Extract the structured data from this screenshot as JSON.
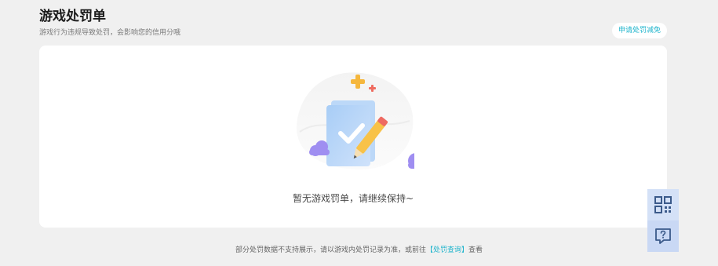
{
  "header": {
    "title": "游戏处罚单",
    "subtitle": "游戏行为违规导致处罚，会影响您的信用分哦",
    "appeal_label": "申请处罚减免"
  },
  "main": {
    "empty_text": "暂无游戏罚单，请继续保持~",
    "illustration_icon": "document-check-pencil-illustration"
  },
  "footer": {
    "note_prefix": "部分处罚数据不支持展示，请以游戏内处罚记录为准，或前往",
    "link_label": "【处罚查询】",
    "note_suffix": "查看"
  },
  "float_bar": {
    "qrcode_icon": "qrcode-icon",
    "help_icon": "help-chat-icon"
  },
  "colors": {
    "accent": "#1fb4cc",
    "background": "#f0f0f0",
    "float_button": "#d4e1f7"
  }
}
